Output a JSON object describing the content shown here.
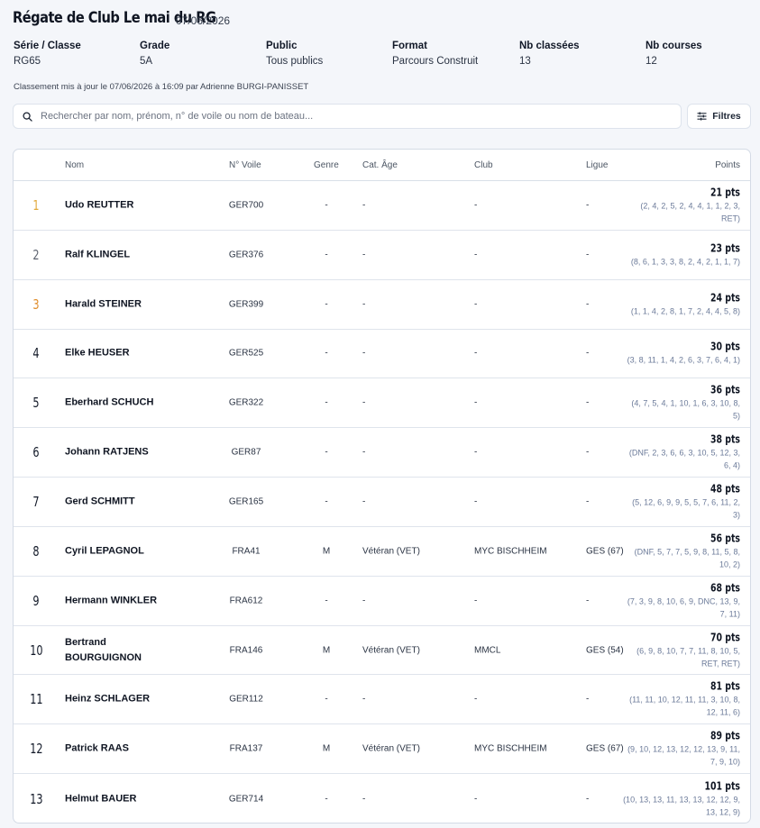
{
  "header": {
    "title": "Régate de Club Le mai du RG",
    "date": "07/06/2026"
  },
  "meta": [
    {
      "label": "Série / Classe",
      "value": "RG65"
    },
    {
      "label": "Grade",
      "value": "5A"
    },
    {
      "label": "Public",
      "value": "Tous publics"
    },
    {
      "label": "Format",
      "value": "Parcours Construit"
    },
    {
      "label": "Nb classées",
      "value": "13"
    },
    {
      "label": "Nb courses",
      "value": "12"
    }
  ],
  "update_text": "Classement mis à jour le 07/06/2026 à 16:09 par Adrienne BURGI-PANISSET",
  "search": {
    "placeholder": "Rechercher par nom, prénom, n° de voile ou nom de bateau..."
  },
  "filter_label": "Filtres",
  "columns": {
    "nom": "Nom",
    "voile": "N° Voile",
    "genre": "Genre",
    "cat": "Cat. Âge",
    "club": "Club",
    "ligue": "Ligue",
    "points": "Points"
  },
  "rows": [
    {
      "rank": "1",
      "name": "Udo REUTTER",
      "sail": "GER700",
      "genre": "-",
      "cat": "-",
      "club": "-",
      "ligue": "-",
      "total": "21 pts",
      "detail": "(2, 4, 2, 5, 2, 4, 4, 1, 1, 2, 3, RET)"
    },
    {
      "rank": "2",
      "name": "Ralf KLINGEL",
      "sail": "GER376",
      "genre": "-",
      "cat": "-",
      "club": "-",
      "ligue": "-",
      "total": "23 pts",
      "detail": "(8, 6, 1, 3, 3, 8, 2, 4, 2, 1, 1, 7)"
    },
    {
      "rank": "3",
      "name": "Harald STEINER",
      "sail": "GER399",
      "genre": "-",
      "cat": "-",
      "club": "-",
      "ligue": "-",
      "total": "24 pts",
      "detail": "(1, 1, 4, 2, 8, 1, 7, 2, 4, 4, 5, 8)"
    },
    {
      "rank": "4",
      "name": "Elke HEUSER",
      "sail": "GER525",
      "genre": "-",
      "cat": "-",
      "club": "-",
      "ligue": "-",
      "total": "30 pts",
      "detail": "(3, 8, 11, 1, 4, 2, 6, 3, 7, 6, 4, 1)"
    },
    {
      "rank": "5",
      "name": "Eberhard SCHUCH",
      "sail": "GER322",
      "genre": "-",
      "cat": "-",
      "club": "-",
      "ligue": "-",
      "total": "36 pts",
      "detail": "(4, 7, 5, 4, 1, 10, 1, 6, 3, 10, 8, 5)"
    },
    {
      "rank": "6",
      "name": "Johann RATJENS",
      "sail": "GER87",
      "genre": "-",
      "cat": "-",
      "club": "-",
      "ligue": "-",
      "total": "38 pts",
      "detail": "(DNF, 2, 3, 6, 6, 3, 10, 5, 12, 3, 6, 4)"
    },
    {
      "rank": "7",
      "name": "Gerd SCHMITT",
      "sail": "GER165",
      "genre": "-",
      "cat": "-",
      "club": "-",
      "ligue": "-",
      "total": "48 pts",
      "detail": "(5, 12, 6, 9, 9, 5, 5, 7, 6, 11, 2, 3)"
    },
    {
      "rank": "8",
      "name": "Cyril LEPAGNOL",
      "sail": "FRA41",
      "genre": "M",
      "cat": "Vétéran (VET)",
      "club": "MYC BISCHHEIM",
      "ligue": "GES (67)",
      "total": "56 pts",
      "detail": "(DNF, 5, 7, 7, 5, 9, 8, 11, 5, 8, 10, 2)"
    },
    {
      "rank": "9",
      "name": "Hermann WINKLER",
      "sail": "FRA612",
      "genre": "-",
      "cat": "-",
      "club": "-",
      "ligue": "-",
      "total": "68 pts",
      "detail": "(7, 3, 9, 8, 10, 6, 9, DNC, 13, 9, 7, 11)"
    },
    {
      "rank": "10",
      "name": "Bertrand BOURGUIGNON",
      "sail": "FRA146",
      "genre": "M",
      "cat": "Vétéran (VET)",
      "club": "MMCL",
      "ligue": "GES (54)",
      "total": "70 pts",
      "detail": "(6, 9, 8, 10, 7, 7, 11, 8, 10, 5, RET, RET)"
    },
    {
      "rank": "11",
      "name": "Heinz SCHLAGER",
      "sail": "GER112",
      "genre": "-",
      "cat": "-",
      "club": "-",
      "ligue": "-",
      "total": "81 pts",
      "detail": "(11, 11, 10, 12, 11, 11, 3, 10, 8, 12, 11, 6)"
    },
    {
      "rank": "12",
      "name": "Patrick RAAS",
      "sail": "FRA137",
      "genre": "M",
      "cat": "Vétéran (VET)",
      "club": "MYC BISCHHEIM",
      "ligue": "GES (67)",
      "total": "89 pts",
      "detail": "(9, 10, 12, 13, 12, 12, 13, 9, 11, 7, 9, 10)"
    },
    {
      "rank": "13",
      "name": "Helmut BAUER",
      "sail": "GER714",
      "genre": "-",
      "cat": "-",
      "club": "-",
      "ligue": "-",
      "total": "101 pts",
      "detail": "(10, 13, 13, 11, 13, 13, 12, 12, 9, 13, 12, 9)"
    }
  ],
  "colors": {
    "gold": "#e2a93b",
    "silver": "#5e6470",
    "bronze": "#e08c2a",
    "accent": "#6b7a99"
  }
}
